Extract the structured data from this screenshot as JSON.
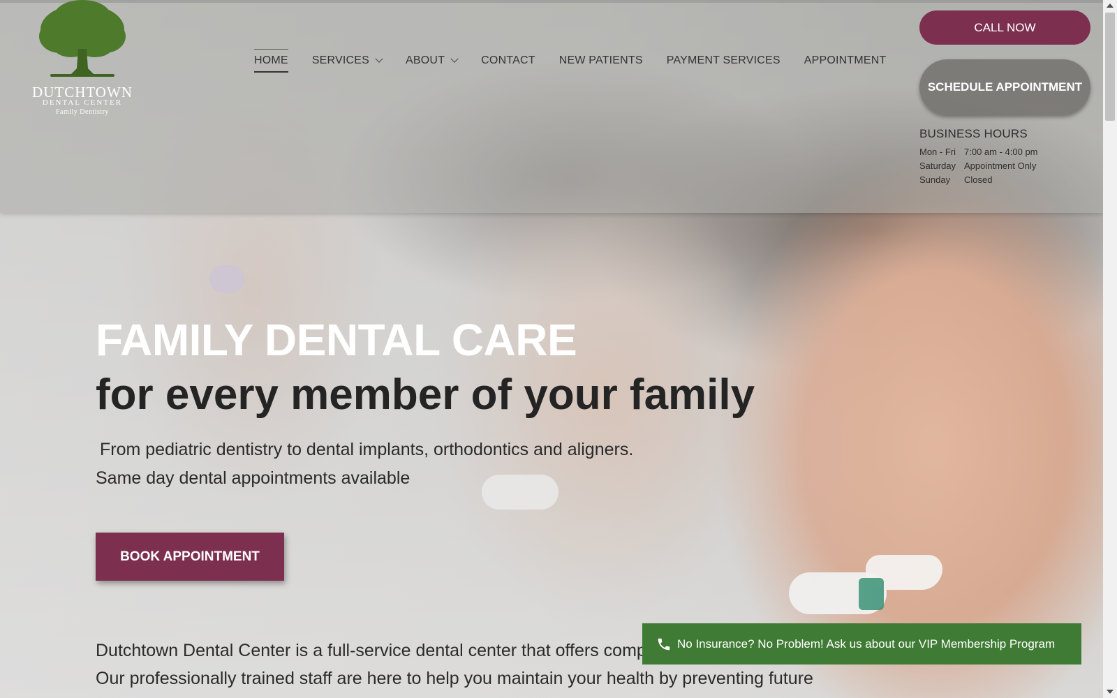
{
  "brand": {
    "name": "DUTCHTOWN",
    "subtitle": "DENTAL CENTER",
    "tagline": "Family Dentistry",
    "logo_icon": "oak-tree-icon",
    "tree_color": "#4e7a2c"
  },
  "nav": {
    "items": [
      {
        "label": "HOME",
        "active": true,
        "dropdown": false
      },
      {
        "label": "SERVICES",
        "active": false,
        "dropdown": true
      },
      {
        "label": "ABOUT",
        "active": false,
        "dropdown": true
      },
      {
        "label": "CONTACT",
        "active": false,
        "dropdown": false
      },
      {
        "label": "NEW PATIENTS",
        "active": false,
        "dropdown": false
      },
      {
        "label": "PAYMENT SERVICES",
        "active": false,
        "dropdown": false
      },
      {
        "label": "APPOINTMENT",
        "active": false,
        "dropdown": false
      }
    ]
  },
  "actions": {
    "call_label": "CALL NOW",
    "schedule_label": "SCHEDULE APPOINTMENT"
  },
  "hours": {
    "title": "BUSINESS HOURS",
    "rows": [
      {
        "day": "Mon - Fri",
        "time": "7:00 am - 4:00 pm"
      },
      {
        "day": "Saturday",
        "time": "Appointment Only"
      },
      {
        "day": "Sunday",
        "time": "Closed"
      }
    ]
  },
  "hero": {
    "title": "FAMILY DENTAL CARE",
    "subtitle": "for every member of your family",
    "desc_line1": "From pediatric dentistry to dental implants, orthodontics and aligners.",
    "desc_line2": "Same day dental appointments available",
    "cta_label": "BOOK APPOINTMENT"
  },
  "intro": {
    "text": "Dutchtown Dental Center is a full-service dental center that offers comprehensive dental care for the whole family. Our professionally trained staff are here to help you maintain your health by preventing future"
  },
  "promo": {
    "text": "No Insurance? No Problem! Ask us about our VIP Membership Program",
    "icon": "phone-icon"
  },
  "colors": {
    "accent": "#7d2f50",
    "promo_green": "#3f7b34"
  }
}
